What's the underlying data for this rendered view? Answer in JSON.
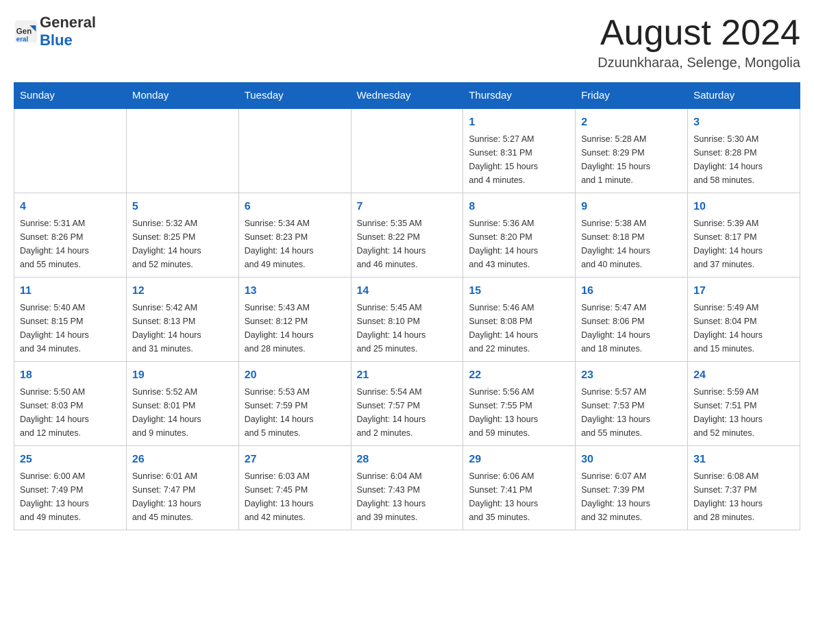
{
  "header": {
    "logo_text_general": "General",
    "logo_text_blue": "Blue",
    "month_title": "August 2024",
    "location": "Dzuunkharaa, Selenge, Mongolia"
  },
  "weekdays": [
    "Sunday",
    "Monday",
    "Tuesday",
    "Wednesday",
    "Thursday",
    "Friday",
    "Saturday"
  ],
  "weeks": [
    [
      {
        "day": "",
        "info": ""
      },
      {
        "day": "",
        "info": ""
      },
      {
        "day": "",
        "info": ""
      },
      {
        "day": "",
        "info": ""
      },
      {
        "day": "1",
        "info": "Sunrise: 5:27 AM\nSunset: 8:31 PM\nDaylight: 15 hours\nand 4 minutes."
      },
      {
        "day": "2",
        "info": "Sunrise: 5:28 AM\nSunset: 8:29 PM\nDaylight: 15 hours\nand 1 minute."
      },
      {
        "day": "3",
        "info": "Sunrise: 5:30 AM\nSunset: 8:28 PM\nDaylight: 14 hours\nand 58 minutes."
      }
    ],
    [
      {
        "day": "4",
        "info": "Sunrise: 5:31 AM\nSunset: 8:26 PM\nDaylight: 14 hours\nand 55 minutes."
      },
      {
        "day": "5",
        "info": "Sunrise: 5:32 AM\nSunset: 8:25 PM\nDaylight: 14 hours\nand 52 minutes."
      },
      {
        "day": "6",
        "info": "Sunrise: 5:34 AM\nSunset: 8:23 PM\nDaylight: 14 hours\nand 49 minutes."
      },
      {
        "day": "7",
        "info": "Sunrise: 5:35 AM\nSunset: 8:22 PM\nDaylight: 14 hours\nand 46 minutes."
      },
      {
        "day": "8",
        "info": "Sunrise: 5:36 AM\nSunset: 8:20 PM\nDaylight: 14 hours\nand 43 minutes."
      },
      {
        "day": "9",
        "info": "Sunrise: 5:38 AM\nSunset: 8:18 PM\nDaylight: 14 hours\nand 40 minutes."
      },
      {
        "day": "10",
        "info": "Sunrise: 5:39 AM\nSunset: 8:17 PM\nDaylight: 14 hours\nand 37 minutes."
      }
    ],
    [
      {
        "day": "11",
        "info": "Sunrise: 5:40 AM\nSunset: 8:15 PM\nDaylight: 14 hours\nand 34 minutes."
      },
      {
        "day": "12",
        "info": "Sunrise: 5:42 AM\nSunset: 8:13 PM\nDaylight: 14 hours\nand 31 minutes."
      },
      {
        "day": "13",
        "info": "Sunrise: 5:43 AM\nSunset: 8:12 PM\nDaylight: 14 hours\nand 28 minutes."
      },
      {
        "day": "14",
        "info": "Sunrise: 5:45 AM\nSunset: 8:10 PM\nDaylight: 14 hours\nand 25 minutes."
      },
      {
        "day": "15",
        "info": "Sunrise: 5:46 AM\nSunset: 8:08 PM\nDaylight: 14 hours\nand 22 minutes."
      },
      {
        "day": "16",
        "info": "Sunrise: 5:47 AM\nSunset: 8:06 PM\nDaylight: 14 hours\nand 18 minutes."
      },
      {
        "day": "17",
        "info": "Sunrise: 5:49 AM\nSunset: 8:04 PM\nDaylight: 14 hours\nand 15 minutes."
      }
    ],
    [
      {
        "day": "18",
        "info": "Sunrise: 5:50 AM\nSunset: 8:03 PM\nDaylight: 14 hours\nand 12 minutes."
      },
      {
        "day": "19",
        "info": "Sunrise: 5:52 AM\nSunset: 8:01 PM\nDaylight: 14 hours\nand 9 minutes."
      },
      {
        "day": "20",
        "info": "Sunrise: 5:53 AM\nSunset: 7:59 PM\nDaylight: 14 hours\nand 5 minutes."
      },
      {
        "day": "21",
        "info": "Sunrise: 5:54 AM\nSunset: 7:57 PM\nDaylight: 14 hours\nand 2 minutes."
      },
      {
        "day": "22",
        "info": "Sunrise: 5:56 AM\nSunset: 7:55 PM\nDaylight: 13 hours\nand 59 minutes."
      },
      {
        "day": "23",
        "info": "Sunrise: 5:57 AM\nSunset: 7:53 PM\nDaylight: 13 hours\nand 55 minutes."
      },
      {
        "day": "24",
        "info": "Sunrise: 5:59 AM\nSunset: 7:51 PM\nDaylight: 13 hours\nand 52 minutes."
      }
    ],
    [
      {
        "day": "25",
        "info": "Sunrise: 6:00 AM\nSunset: 7:49 PM\nDaylight: 13 hours\nand 49 minutes."
      },
      {
        "day": "26",
        "info": "Sunrise: 6:01 AM\nSunset: 7:47 PM\nDaylight: 13 hours\nand 45 minutes."
      },
      {
        "day": "27",
        "info": "Sunrise: 6:03 AM\nSunset: 7:45 PM\nDaylight: 13 hours\nand 42 minutes."
      },
      {
        "day": "28",
        "info": "Sunrise: 6:04 AM\nSunset: 7:43 PM\nDaylight: 13 hours\nand 39 minutes."
      },
      {
        "day": "29",
        "info": "Sunrise: 6:06 AM\nSunset: 7:41 PM\nDaylight: 13 hours\nand 35 minutes."
      },
      {
        "day": "30",
        "info": "Sunrise: 6:07 AM\nSunset: 7:39 PM\nDaylight: 13 hours\nand 32 minutes."
      },
      {
        "day": "31",
        "info": "Sunrise: 6:08 AM\nSunset: 7:37 PM\nDaylight: 13 hours\nand 28 minutes."
      }
    ]
  ]
}
